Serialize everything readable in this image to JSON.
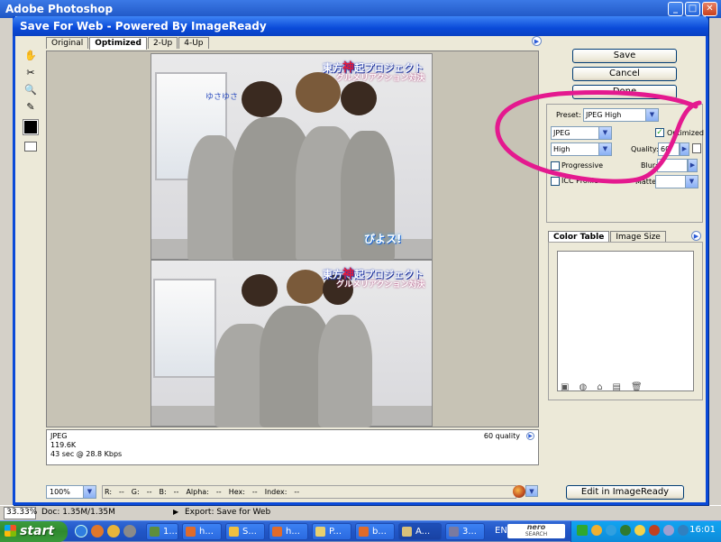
{
  "background_app": {
    "title": "Adobe Photoshop",
    "status": {
      "zoom": "33.33%",
      "doc": "Doc: 1.35M/1.35M",
      "export": "Export: Save for Web"
    }
  },
  "dialog": {
    "title": "Save For Web - Powered By ImageReady",
    "tabs": [
      "Original",
      "Optimized",
      "2-Up",
      "4-Up"
    ],
    "active_tab": "Optimized",
    "buttons": {
      "save": "Save",
      "cancel": "Cancel",
      "done": "Done",
      "edit_imageready": "Edit in ImageReady"
    },
    "image": {
      "caption_line1_a": "東方",
      "caption_line1_red": "神",
      "caption_line1_b": "起プロジェクト",
      "caption_line2": "グルメリアクション対決",
      "logo": "びよス!",
      "note": "ゆさゆさ"
    },
    "info": {
      "format": "JPEG",
      "size": "119.6K",
      "time": "43 sec @ 28.8 Kbps",
      "quality_label": "60 quality"
    },
    "bottom": {
      "zoom": "100%",
      "readout": [
        "R:",
        "--",
        "G:",
        "--",
        "B:",
        "--",
        "Alpha:",
        "--",
        "Hex:",
        "--",
        "Index:",
        "--"
      ]
    },
    "settings": {
      "preset_label": "Preset:",
      "preset_value": "JPEG High",
      "format_value": "JPEG",
      "quality_level": "High",
      "optimized_label": "Optimized",
      "optimized_checked": true,
      "quality_label": "Quality:",
      "quality_value": "60",
      "progressive_label": "Progressive",
      "blur_label": "Blur:",
      "icc_label": "ICC Profile",
      "matte_label": "Matte:"
    },
    "color_table": {
      "tabs": [
        "Color Table",
        "Image Size"
      ],
      "active_tab": "Color Table"
    }
  },
  "taskbar": {
    "start_label": "start",
    "items": [
      {
        "label": "1..."
      },
      {
        "label": "h..."
      },
      {
        "label": "S..."
      },
      {
        "label": "h..."
      },
      {
        "label": "P..."
      },
      {
        "label": "b..."
      },
      {
        "label": "A..."
      },
      {
        "label": "3..."
      }
    ],
    "language": "EN",
    "search_brand": "nero",
    "search_sub": "SEARCH",
    "clock": "16:01"
  },
  "colors": {
    "annotation": "#e4198f",
    "title_blue": "#0a4ad8",
    "taskbar_blue": "#2156c7",
    "start_green": "#2f8a2f"
  }
}
